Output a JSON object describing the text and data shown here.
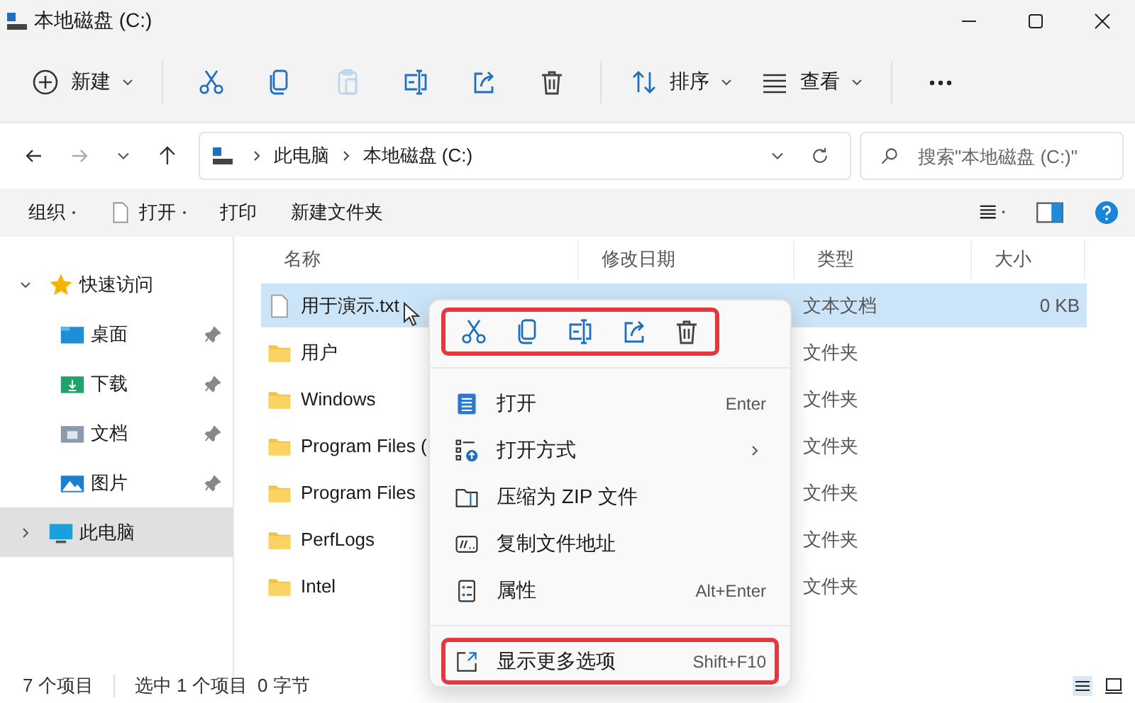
{
  "window": {
    "title": "本地磁盘 (C:)"
  },
  "toolbar": [
    {
      "kind": "new",
      "label": "新建",
      "dropdown": true,
      "disabled": false
    },
    {
      "kind": "cut",
      "disabled": false
    },
    {
      "kind": "copy",
      "disabled": false
    },
    {
      "kind": "paste",
      "disabled": true
    },
    {
      "kind": "rename",
      "disabled": false
    },
    {
      "kind": "share",
      "disabled": false
    },
    {
      "kind": "delete",
      "disabled": false
    },
    {
      "kind": "sort",
      "label": "排序",
      "dropdown": true,
      "disabled": false
    },
    {
      "kind": "view",
      "label": "查看",
      "dropdown": true,
      "disabled": false
    },
    {
      "kind": "more",
      "disabled": false
    }
  ],
  "address": {
    "path": [
      "此电脑",
      "本地磁盘 (C:)"
    ]
  },
  "search": {
    "placeholder": "搜索\"本地磁盘 (C:)\""
  },
  "commands": [
    {
      "label": "组织",
      "dropdown": true
    },
    {
      "label": "打开",
      "dropdown": true,
      "icon": true
    },
    {
      "label": "打印",
      "dropdown": false
    },
    {
      "label": "新建文件夹",
      "dropdown": false
    }
  ],
  "sidebar": {
    "items": [
      {
        "kind": "star",
        "label": "快速访问",
        "expanded": true,
        "selected": false,
        "children": [
          {
            "kind": "desktop",
            "label": "桌面",
            "pinned": true,
            "selected": false
          },
          {
            "kind": "download",
            "label": "下载",
            "pinned": true,
            "selected": false
          },
          {
            "kind": "docs",
            "label": "文档",
            "pinned": true,
            "selected": false
          },
          {
            "kind": "pictures",
            "label": "图片",
            "pinned": true,
            "selected": false
          }
        ]
      },
      {
        "kind": "pc",
        "label": "此电脑",
        "expanded": false,
        "selected": true
      }
    ]
  },
  "table": {
    "columns": [
      "名称",
      "修改日期",
      "类型",
      "大小"
    ],
    "rows": [
      {
        "kind": "file",
        "name": "用于演示.txt",
        "type": "文本文档",
        "size": "0 KB",
        "selected": true
      },
      {
        "kind": "folder",
        "name": "用户",
        "type": "文件夹",
        "selected": false
      },
      {
        "kind": "folder",
        "name": "Windows",
        "type": "文件夹",
        "selected": false
      },
      {
        "kind": "folder",
        "name": "Program Files (",
        "type": "文件夹",
        "selected": false
      },
      {
        "kind": "folder",
        "name": "Program Files",
        "type": "文件夹",
        "selected": false
      },
      {
        "kind": "folder",
        "name": "PerfLogs",
        "type": "文件夹",
        "selected": false
      },
      {
        "kind": "folder",
        "name": "Intel",
        "type": "文件夹",
        "selected": false
      }
    ]
  },
  "context_menu": {
    "icon_bar": {
      "highlighted": true,
      "icons": [
        {
          "kind": "cut"
        },
        {
          "kind": "copy"
        },
        {
          "kind": "rename"
        },
        {
          "kind": "share"
        },
        {
          "kind": "delete"
        }
      ]
    },
    "items": [
      {
        "kind": "open",
        "label": "打开",
        "shortcut": "Enter",
        "submenu": false,
        "highlighted": false
      },
      {
        "kind": "openwith",
        "label": "打开方式",
        "submenu": true,
        "highlighted": false
      },
      {
        "kind": "zip",
        "label": "压缩为 ZIP 文件",
        "submenu": false,
        "highlighted": false
      },
      {
        "kind": "path",
        "label": "复制文件地址",
        "submenu": false,
        "highlighted": false
      },
      {
        "kind": "props",
        "label": "属性",
        "shortcut": "Alt+Enter",
        "submenu": false,
        "highlighted": false
      },
      {
        "kind": "expand",
        "label": "显示更多选项",
        "shortcut": "Shift+F10",
        "submenu": false,
        "highlighted": true,
        "separated": true
      }
    ]
  },
  "status_bar": {
    "count": "7 个项目",
    "selection": "选中 1 个项目  0 字节"
  }
}
